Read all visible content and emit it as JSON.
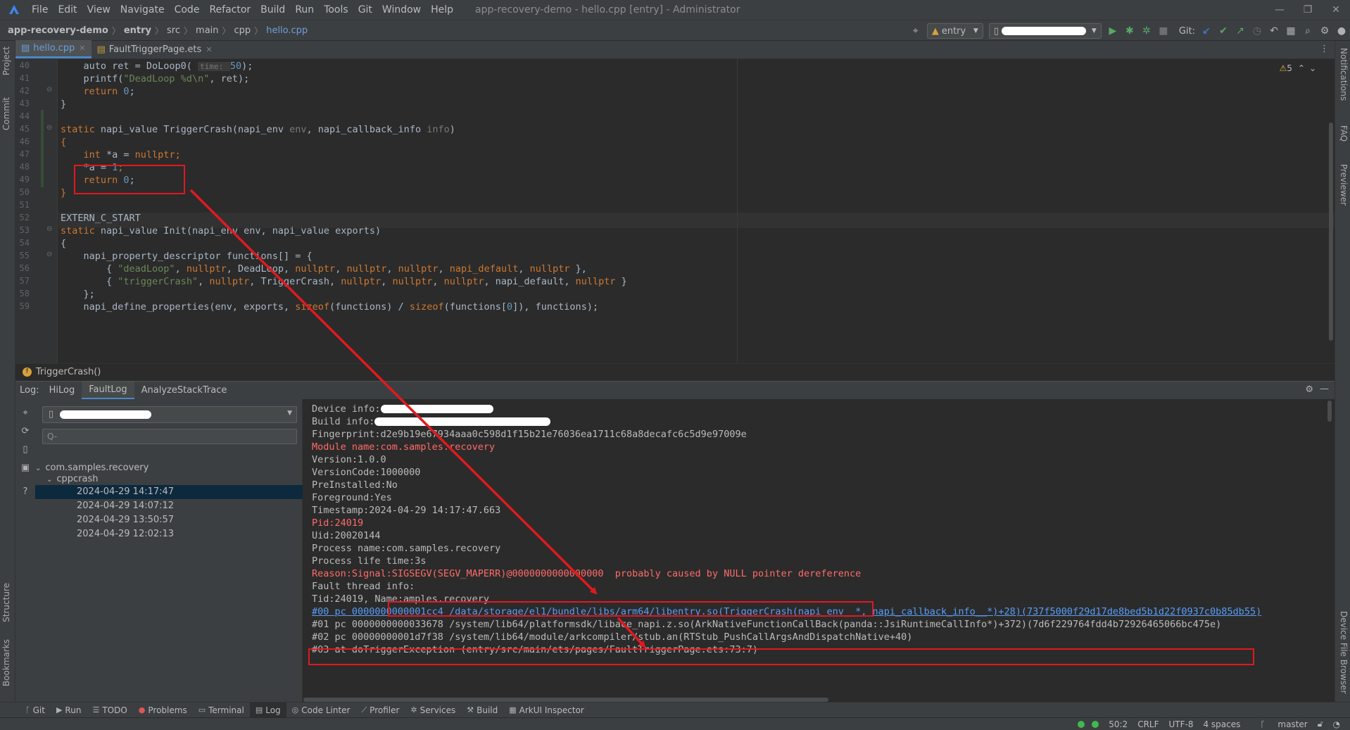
{
  "window": {
    "title": "app-recovery-demo - hello.cpp [entry] - Administrator",
    "menu": [
      "File",
      "Edit",
      "View",
      "Navigate",
      "Code",
      "Refactor",
      "Build",
      "Run",
      "Tools",
      "Git",
      "Window",
      "Help"
    ]
  },
  "breadcrumbs": [
    "app-recovery-demo",
    "entry",
    "src",
    "main",
    "cpp",
    "hello.cpp"
  ],
  "toolbar": {
    "module": "entry",
    "git_label": "Git:"
  },
  "left_strip": [
    "Project",
    "Commit",
    "Structure",
    "Bookmarks"
  ],
  "right_strip": [
    "Notifications",
    "FAQ",
    "Previewer",
    "Device File Browser"
  ],
  "editor_tabs": [
    {
      "label": "hello.cpp"
    },
    {
      "label": "FaultTriggerPage.ets"
    }
  ],
  "editor": {
    "warnings": "5",
    "lines": [
      {
        "n": "40",
        "tokens": [
          {
            "t": "    auto ret = DoLoop0( ",
            "c": ""
          },
          {
            "t": "time: ",
            "c": "hint"
          },
          {
            "t": "50",
            "c": "num"
          },
          {
            "t": ");",
            "c": ""
          }
        ]
      },
      {
        "n": "41",
        "tokens": [
          {
            "t": "    printf(",
            "c": ""
          },
          {
            "t": "\"DeadLoop %d\\n\"",
            "c": "str"
          },
          {
            "t": ", ret);",
            "c": ""
          }
        ]
      },
      {
        "n": "42",
        "tokens": [
          {
            "t": "    ",
            "c": ""
          },
          {
            "t": "return ",
            "c": "kw"
          },
          {
            "t": "0",
            "c": "num"
          },
          {
            "t": ";",
            "c": ""
          }
        ]
      },
      {
        "n": "43",
        "tokens": [
          {
            "t": "}",
            "c": ""
          }
        ]
      },
      {
        "n": "44",
        "tokens": [
          {
            "t": "",
            "c": ""
          }
        ]
      },
      {
        "n": "45",
        "tokens": [
          {
            "t": "static ",
            "c": "kw"
          },
          {
            "t": "napi_value TriggerCrash(napi_env ",
            "c": ""
          },
          {
            "t": "env",
            "c": "par"
          },
          {
            "t": ", napi_callback_info ",
            "c": ""
          },
          {
            "t": "info",
            "c": "par"
          },
          {
            "t": ")",
            "c": ""
          }
        ]
      },
      {
        "n": "46",
        "tokens": [
          {
            "t": "{",
            "c": "kw"
          }
        ]
      },
      {
        "n": "47",
        "tokens": [
          {
            "t": "    ",
            "c": ""
          },
          {
            "t": "int ",
            "c": "kw"
          },
          {
            "t": "*a = ",
            "c": ""
          },
          {
            "t": "nullptr",
            "c": "kw"
          },
          {
            "t": ";",
            "c": "kw"
          }
        ]
      },
      {
        "n": "48",
        "tokens": [
          {
            "t": "    *a = ",
            "c": ""
          },
          {
            "t": "1",
            "c": "num"
          },
          {
            "t": ";",
            "c": "kw"
          }
        ]
      },
      {
        "n": "49",
        "tokens": [
          {
            "t": "    ",
            "c": ""
          },
          {
            "t": "return ",
            "c": "kw"
          },
          {
            "t": "0",
            "c": "num"
          },
          {
            "t": ";",
            "c": ""
          }
        ]
      },
      {
        "n": "50",
        "tokens": [
          {
            "t": "}",
            "c": "kw"
          }
        ]
      },
      {
        "n": "51",
        "tokens": [
          {
            "t": "",
            "c": ""
          }
        ]
      },
      {
        "n": "52",
        "tokens": [
          {
            "t": "EXTERN_C_START",
            "c": ""
          }
        ]
      },
      {
        "n": "53",
        "tokens": [
          {
            "t": "static ",
            "c": "kw"
          },
          {
            "t": "napi_value Init(napi_env env, napi_value exports)",
            "c": ""
          }
        ]
      },
      {
        "n": "54",
        "tokens": [
          {
            "t": "{",
            "c": ""
          }
        ]
      },
      {
        "n": "55",
        "tokens": [
          {
            "t": "    napi_property_descriptor functions[] = {",
            "c": ""
          }
        ]
      },
      {
        "n": "56",
        "tokens": [
          {
            "t": "        { ",
            "c": ""
          },
          {
            "t": "\"deadLoop\"",
            "c": "str"
          },
          {
            "t": ", ",
            "c": ""
          },
          {
            "t": "nullptr",
            "c": "kw"
          },
          {
            "t": ", DeadLoop, ",
            "c": ""
          },
          {
            "t": "nullptr",
            "c": "kw"
          },
          {
            "t": ", ",
            "c": ""
          },
          {
            "t": "nullptr",
            "c": "kw"
          },
          {
            "t": ", ",
            "c": ""
          },
          {
            "t": "nullptr",
            "c": "kw"
          },
          {
            "t": ", ",
            "c": ""
          },
          {
            "t": "napi_default",
            "c": "kw"
          },
          {
            "t": ", ",
            "c": ""
          },
          {
            "t": "nullptr",
            "c": "kw"
          },
          {
            "t": " },",
            "c": ""
          }
        ]
      },
      {
        "n": "57",
        "tokens": [
          {
            "t": "        { ",
            "c": ""
          },
          {
            "t": "\"triggerCrash\"",
            "c": "str"
          },
          {
            "t": ", ",
            "c": ""
          },
          {
            "t": "nullptr",
            "c": "kw"
          },
          {
            "t": ", TriggerCrash, ",
            "c": ""
          },
          {
            "t": "nullptr",
            "c": "kw"
          },
          {
            "t": ", ",
            "c": ""
          },
          {
            "t": "nullptr",
            "c": "kw"
          },
          {
            "t": ", ",
            "c": ""
          },
          {
            "t": "nullptr",
            "c": "kw"
          },
          {
            "t": ", napi_default, ",
            "c": ""
          },
          {
            "t": "nullptr",
            "c": "kw"
          },
          {
            "t": " }",
            "c": ""
          }
        ]
      },
      {
        "n": "58",
        "tokens": [
          {
            "t": "    };",
            "c": ""
          }
        ]
      },
      {
        "n": "59",
        "tokens": [
          {
            "t": "    napi_define_properties(env, exports, ",
            "c": ""
          },
          {
            "t": "sizeof",
            "c": "kw"
          },
          {
            "t": "(functions) / ",
            "c": ""
          },
          {
            "t": "sizeof",
            "c": "kw"
          },
          {
            "t": "(functions[",
            "c": ""
          },
          {
            "t": "0",
            "c": "num"
          },
          {
            "t": "]), functions);",
            "c": ""
          }
        ]
      }
    ]
  },
  "function_breadcrumb": "TriggerCrash()",
  "log": {
    "label": "Log:",
    "tabs": [
      "HiLog",
      "FaultLog",
      "AnalyzeStackTrace"
    ],
    "search_placeholder": "Q-",
    "tree": {
      "root": "com.samples.recovery",
      "child": "cppcrash",
      "entries": [
        "2024-04-29 14:17:47",
        "2024-04-29 14:07:12",
        "2024-04-29 13:50:57",
        "2024-04-29 12:02:13"
      ]
    },
    "lines": [
      {
        "text": "Device info:",
        "style": "",
        "redact": 160
      },
      {
        "text": "Build info:",
        "style": "",
        "redact": 250
      },
      {
        "text": "Fingerprint:d2e9b19e67934aaa0c598d1f15b21e76036ea1711c68a8decafc6c5d9e97009e",
        "style": ""
      },
      {
        "text": "Module name:com.samples.recovery",
        "style": "red"
      },
      {
        "text": "Version:1.0.0",
        "style": ""
      },
      {
        "text": "VersionCode:1000000",
        "style": ""
      },
      {
        "text": "PreInstalled:No",
        "style": ""
      },
      {
        "text": "Foreground:Yes",
        "style": ""
      },
      {
        "text": "Timestamp:2024-04-29 14:17:47.663",
        "style": ""
      },
      {
        "text": "Pid:24019",
        "style": "red"
      },
      {
        "text": "Uid:20020144",
        "style": ""
      },
      {
        "text": "Process name:com.samples.recovery",
        "style": ""
      },
      {
        "text": "Process life time:3s",
        "style": ""
      },
      {
        "text": "Reason:Signal:SIGSEGV(SEGV_MAPERR)@0000000000000000  probably caused by NULL pointer dereference",
        "style": "red"
      },
      {
        "text": "Fault thread info:",
        "style": ""
      },
      {
        "text": "Tid:24019, Name:amples.recovery",
        "style": ""
      },
      {
        "text": "#00 pc 0000000000001cc4 /data/storage/el1/bundle/libs/arm64/libentry.so(TriggerCrash(napi_env__*, napi_callback_info__*)+28)(737f5000f29d17de8bed5b1d22f0937c0b85db55)",
        "style": "link"
      },
      {
        "text": "#01 pc 0000000000033678 /system/lib64/platformsdk/libace_napi.z.so(ArkNativeFunctionCallBack(panda::JsiRuntimeCallInfo*)+372)(7d6f229764fdd4b72926465066bc475e)",
        "style": ""
      },
      {
        "text": "#02 pc 00000000001d7f38 /system/lib64/module/arkcompiler/stub.an(RTStub_PushCallArgsAndDispatchNative+40)",
        "style": ""
      },
      {
        "text": "#03 at doTriggerException (entry/src/main/ets/pages/FaultTriggerPage.ets:73:7)",
        "style": ""
      }
    ]
  },
  "bottom_tools": [
    "Git",
    "Run",
    "TODO",
    "Problems",
    "Terminal",
    "Log",
    "Code Linter",
    "Profiler",
    "Services",
    "Build",
    "ArkUI Inspector"
  ],
  "bottom_icons": [
    "branch-icon",
    "play-icon",
    "list-icon",
    "error-icon",
    "terminal-icon",
    "log-icon",
    "linter-icon",
    "profiler-icon",
    "services-icon",
    "hammer-icon",
    "inspector-icon"
  ],
  "status": {
    "position": "50:2",
    "line_sep": "CRLF",
    "encoding": "UTF-8",
    "indent": "4 spaces",
    "branch": "master"
  }
}
